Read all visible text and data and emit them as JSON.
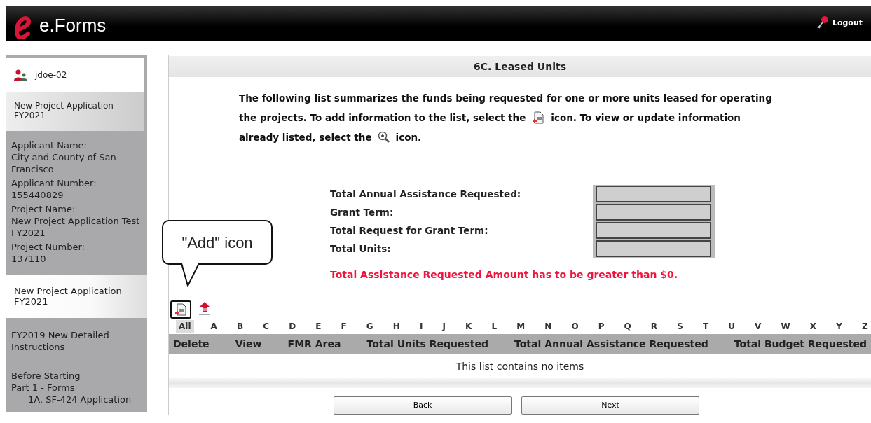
{
  "header": {
    "logo_text": "e.Forms",
    "logout": "Logout"
  },
  "sidebar": [
    {
      "kind": "user",
      "label": "jdoe-02"
    },
    {
      "kind": "tab",
      "label": "New Project Application FY2021",
      "selected": false
    },
    {
      "kind": "info",
      "fields": [
        {
          "label": "Applicant Name:",
          "value": "City and County of San Francisco"
        },
        {
          "label": "Applicant Number:",
          "value": "155440829"
        },
        {
          "label": "Project Name:",
          "value": "New Project Application Test FY2021"
        },
        {
          "label": "Project Number:",
          "value": "137110"
        }
      ]
    },
    {
      "kind": "tab",
      "label": "New Project Application FY2021",
      "selected": true
    },
    {
      "kind": "menu",
      "items": [
        {
          "label": "FY2019 New Detailed Instructions"
        },
        {
          "label": "Before Starting"
        },
        {
          "label": "Part 1 - Forms",
          "children": [
            {
              "label": "1A. SF-424 Application"
            }
          ]
        }
      ]
    }
  ],
  "page_title": "6C. Leased Units",
  "intro": [
    [
      "The following list summarizes the funds being requested for one or more units leased for operating"
    ],
    [
      "the projects. To add information to the list, select the",
      "icon. To view or update information"
    ],
    [
      "already listed, select the",
      "icon."
    ]
  ],
  "summary": [
    {
      "label": "Total Annual Assistance Requested:",
      "disabled": true
    },
    {
      "label": "Grant Term:",
      "disabled": true
    },
    {
      "label": "Total Request for Grant Term:",
      "disabled": true
    },
    {
      "label": "Total Units:",
      "disabled": true
    }
  ],
  "error": "Total Assistance Requested Amount has to be greater than $0.",
  "callout": "\"Add\" icon",
  "letters": [
    {
      "label": "All",
      "selected": true
    },
    {
      "label": "A",
      "selected": false
    },
    {
      "label": "B",
      "selected": false
    },
    {
      "label": "C",
      "selected": false
    },
    {
      "label": "D",
      "selected": false
    },
    {
      "label": "E",
      "selected": false
    },
    {
      "label": "F",
      "selected": false
    },
    {
      "label": "G",
      "selected": false
    },
    {
      "label": "H",
      "selected": false
    },
    {
      "label": "I",
      "selected": false
    },
    {
      "label": "J",
      "selected": false
    },
    {
      "label": "K",
      "selected": false
    },
    {
      "label": "L",
      "selected": false
    },
    {
      "label": "M",
      "selected": false
    },
    {
      "label": "N",
      "selected": false
    },
    {
      "label": "O",
      "selected": false
    },
    {
      "label": "P",
      "selected": false
    },
    {
      "label": "Q",
      "selected": false
    },
    {
      "label": "R",
      "selected": false
    },
    {
      "label": "S",
      "selected": false
    },
    {
      "label": "T",
      "selected": false
    },
    {
      "label": "U",
      "selected": false
    },
    {
      "label": "V",
      "selected": false
    },
    {
      "label": "W",
      "selected": false
    },
    {
      "label": "X",
      "selected": false
    },
    {
      "label": "Y",
      "selected": false
    },
    {
      "label": "Z",
      "selected": false
    }
  ],
  "table": {
    "columns": [
      "Delete",
      "View",
      "FMR Area",
      "Total Units Requested",
      "Total Annual Assistance Requested",
      "Total Budget Requested"
    ],
    "empty_message": "This list contains no items"
  },
  "buttons": [
    "Back",
    "Next"
  ]
}
